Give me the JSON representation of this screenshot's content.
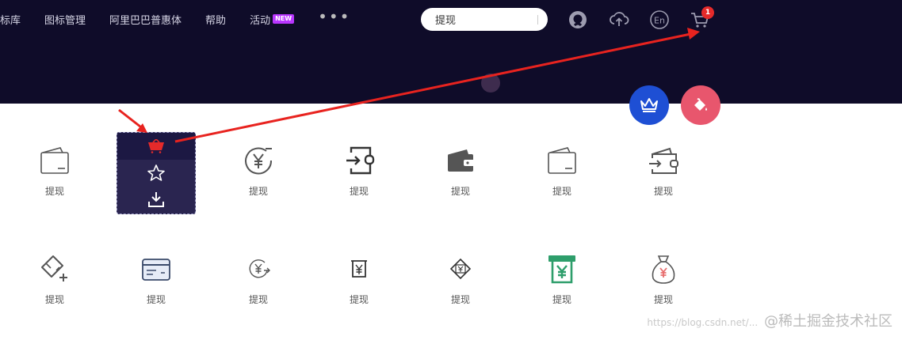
{
  "nav": {
    "items": [
      "图标库",
      "图标管理",
      "阿里巴巴普惠体",
      "帮助",
      "活动"
    ],
    "new_badge": "NEW",
    "more": "•••"
  },
  "search": {
    "value": "提现"
  },
  "header_icons": [
    "github-icon",
    "upload-cloud-icon",
    "language-en-icon",
    "cart-icon"
  ],
  "cart_count": "1",
  "lang_label": "En",
  "fabs": [
    "crown-icon",
    "paint-bucket-icon"
  ],
  "hover_actions": [
    "add-to-cart-icon",
    "star-icon",
    "download-icon"
  ],
  "row1": [
    {
      "icon": "wallet-outline-icon",
      "label": "提现"
    },
    {
      "icon": "hidden-under-card",
      "label": "提现"
    },
    {
      "icon": "yen-circle-minus-icon",
      "label": "提现"
    },
    {
      "icon": "exit-arrow-icon",
      "label": "提现"
    },
    {
      "icon": "wallet-filled-icon",
      "label": "提现"
    },
    {
      "icon": "wallet-outline-icon",
      "label": "提现"
    },
    {
      "icon": "wallet-transfer-icon",
      "label": "提现"
    }
  ],
  "row2": [
    {
      "icon": "card-plus-icon",
      "label": "提现"
    },
    {
      "icon": "bank-card-icon",
      "label": "提现"
    },
    {
      "icon": "yen-cycle-icon",
      "label": "提现"
    },
    {
      "icon": "yen-receipt-icon",
      "label": "提现"
    },
    {
      "icon": "yen-diamond-icon",
      "label": "提现"
    },
    {
      "icon": "atm-yen-icon",
      "label": "提现"
    },
    {
      "icon": "money-bag-yen-icon",
      "label": "提现"
    }
  ],
  "watermark": {
    "url": "https://blog.csdn.net/...",
    "brand": "@稀土掘金技术社区"
  },
  "colors": {
    "header_bg": "#0f0c29",
    "accent_red": "#e52a2a",
    "fab_blue": "#1e4fd4",
    "fab_pink": "#e8566d",
    "atm_green": "#2e9e6b",
    "bag_red": "#e86d6d"
  }
}
